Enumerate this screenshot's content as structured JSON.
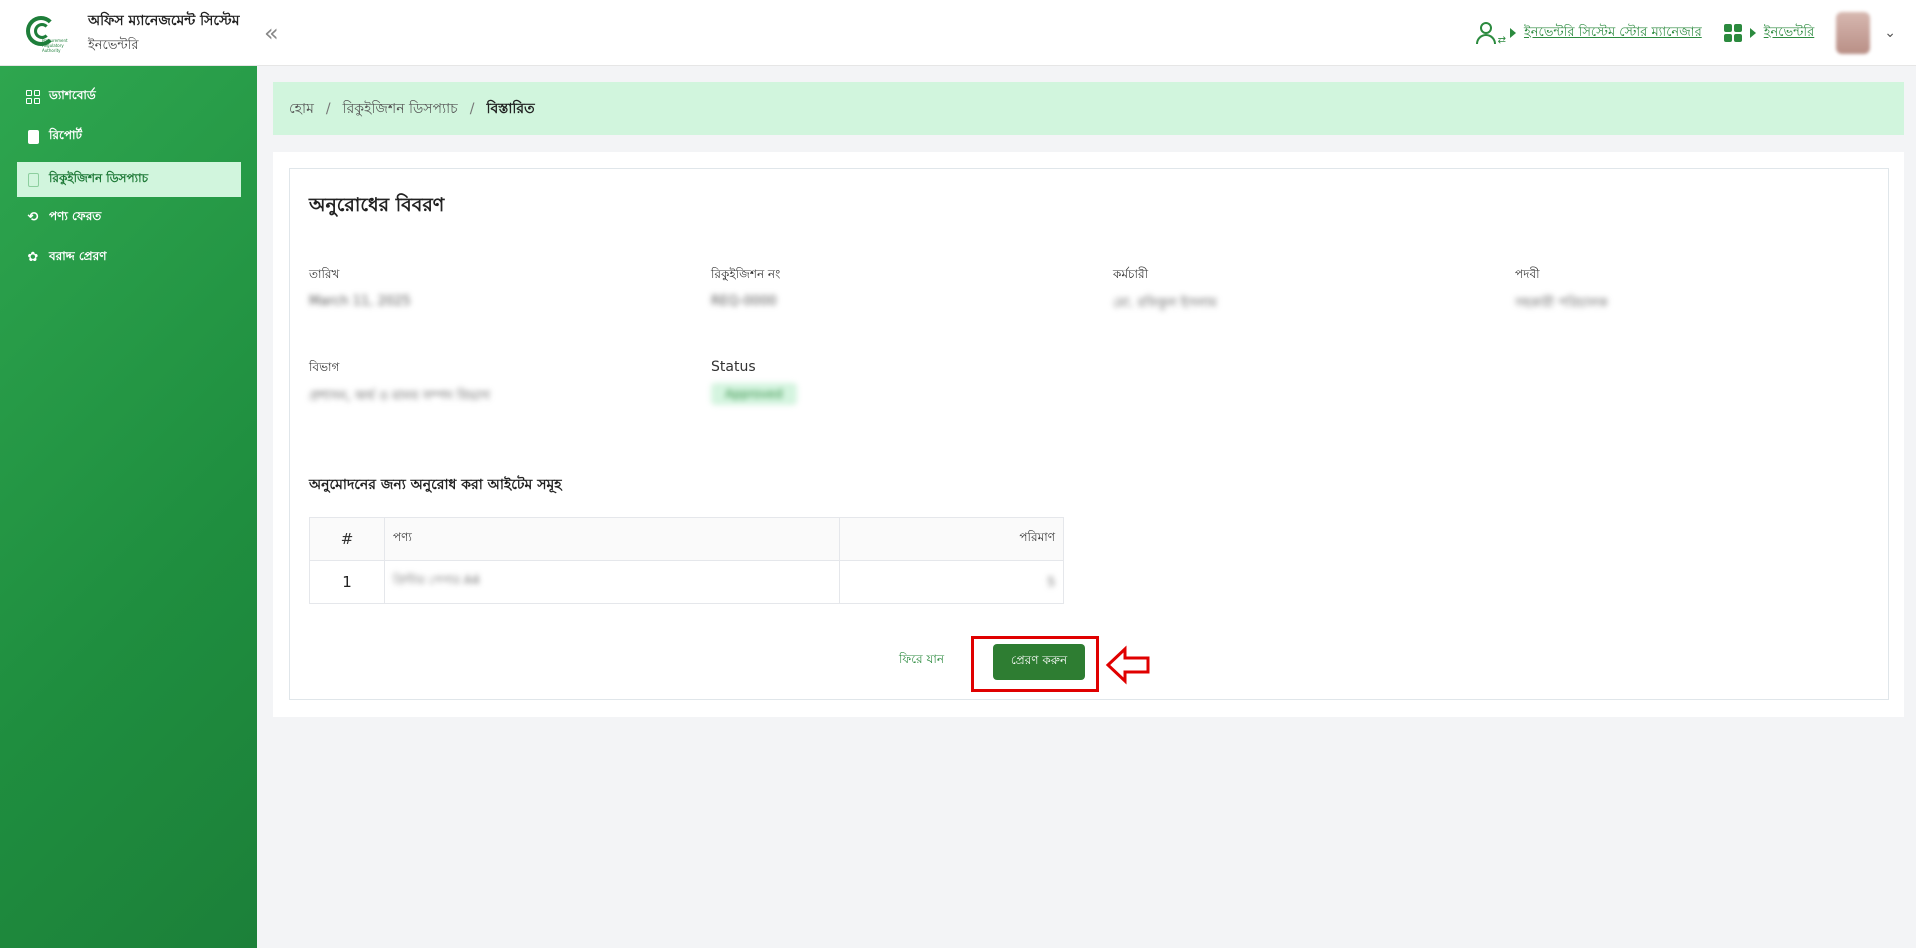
{
  "header": {
    "app_title": "অফিস ম্যানেজমেন্ট সিস্টেম",
    "app_subtitle": "ইনভেন্টরি",
    "logo_text": "Procurement Regulatory Authority",
    "role_link": "ইনভেন্টরি সিস্টেম স্টোর ম্যানেজার",
    "module_link": "ইনভেন্টরি",
    "collapse_glyph": "«",
    "dropdown_glyph": "⌄"
  },
  "sidebar": {
    "items": [
      {
        "label": "ড্যাশবোর্ড",
        "icon": "dashboard-grid-icon",
        "active": false
      },
      {
        "label": "রিপোর্ট",
        "icon": "document-icon",
        "active": false
      },
      {
        "label": "রিকুইজিশন ডিসপ্যাচ",
        "icon": "document-outline-icon",
        "active": true
      },
      {
        "label": "পণ্য ফেরত",
        "icon": "return-icon",
        "active": false
      },
      {
        "label": "বরাদ্দ প্রেরণ",
        "icon": "allocation-icon",
        "active": false
      }
    ]
  },
  "breadcrumb": {
    "home": "হোম",
    "parent": "রিকুইজিশন ডিসপ্যাচ",
    "current": "বিস্তারিত",
    "separator": "/"
  },
  "details": {
    "title": "অনুরোধের বিবরণ",
    "fields": {
      "date_label": "তারিখ",
      "date_value": "March 11, 2025",
      "req_no_label": "রিকুইজিশন নং",
      "req_no_value": "REQ-0000",
      "employee_label": "কর্মচারী",
      "employee_value": "মো. রফিকুল ইসলাম",
      "designation_label": "পদবী",
      "designation_value": "সহকারী পরিচালক",
      "department_label": "বিভাগ",
      "department_value": "প্রশাসন, অর্থ ও মানব সম্পদ বিভাগ",
      "status_label": "Status",
      "status_value": "Approved"
    },
    "items_title": "অনুমোদনের জন্য অনুরোধ করা আইটেম সমূহ",
    "table": {
      "headers": [
        "#",
        "পণ্য",
        "পরিমাণ"
      ],
      "rows": [
        {
          "index": "1",
          "product": "প্রিন্টার পেপার A4",
          "qty": "5"
        }
      ]
    },
    "back_label": "ফিরে যান",
    "send_label": "প্রেরণ করুন"
  },
  "colors": {
    "brand_green": "#2e7d32",
    "sidebar_green": "#23994a",
    "highlight_red": "#e00000",
    "breadcrumb_bg": "#d1f5dd"
  }
}
